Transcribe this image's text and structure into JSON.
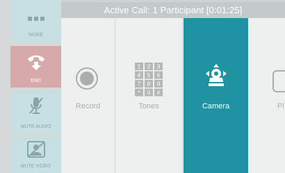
{
  "header": {
    "title": "Active Call: 1 Participant [0:01:25]"
  },
  "sidebar": {
    "items": [
      {
        "label": "MORE",
        "icon": "more-dots-icon"
      },
      {
        "label": "END",
        "icon": "end-call-icon"
      },
      {
        "label": "MUTE AUDIO",
        "icon": "muted-mic-icon"
      },
      {
        "label": "MUTE VIDEO",
        "icon": "muted-video-icon"
      }
    ]
  },
  "tiles": [
    {
      "label": "Record",
      "icon": "record-icon"
    },
    {
      "label": "Tones",
      "icon": "keypad-icon"
    },
    {
      "label": "Camera",
      "icon": "camera-control-icon",
      "selected": true
    },
    {
      "label": "Pl",
      "icon": "partial-icon"
    }
  ],
  "keypad": [
    "1",
    "2",
    "3",
    "4",
    "5",
    "6",
    "7",
    "8",
    "9",
    "*",
    "0",
    "#"
  ],
  "colors": {
    "accent": "#1f93a1",
    "end": "#d8a9ab",
    "sidebar_button": "#c7e1e3",
    "title_bar": "#c4c9c9"
  }
}
